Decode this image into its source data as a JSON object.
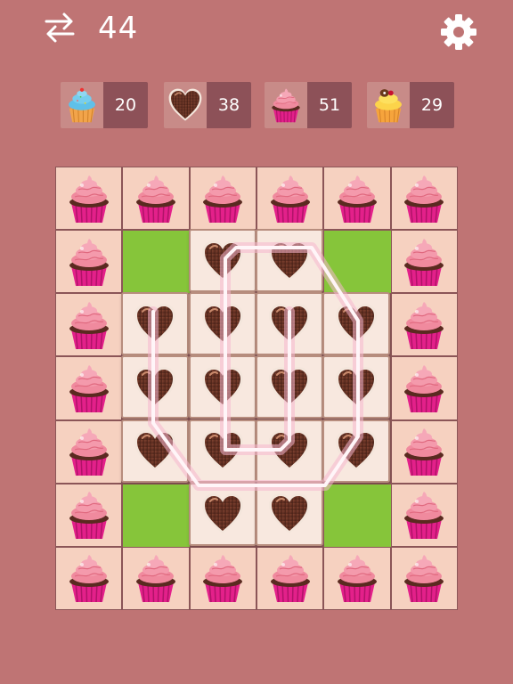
{
  "moves": "44",
  "goals": [
    {
      "item": "blue-cupcake",
      "count": "20"
    },
    {
      "item": "chocolate-heart",
      "count": "38"
    },
    {
      "item": "pink-cupcake",
      "count": "51"
    },
    {
      "item": "orange-cupcake",
      "count": "29"
    }
  ],
  "colors": {
    "background": "#bf7474",
    "board_cell": "#f6d1c0",
    "grass": "#86c53a",
    "path_glow": "#f4a9c6"
  },
  "board": {
    "rows": 7,
    "cols": 6,
    "layout": [
      [
        "pink-cupcake",
        "pink-cupcake",
        "pink-cupcake",
        "pink-cupcake",
        "pink-cupcake",
        "pink-cupcake"
      ],
      [
        "pink-cupcake",
        "grass",
        "chocolate-heart",
        "chocolate-heart",
        "grass",
        "pink-cupcake"
      ],
      [
        "pink-cupcake",
        "chocolate-heart",
        "chocolate-heart",
        "chocolate-heart",
        "chocolate-heart",
        "pink-cupcake"
      ],
      [
        "pink-cupcake",
        "chocolate-heart",
        "chocolate-heart",
        "chocolate-heart",
        "chocolate-heart",
        "pink-cupcake"
      ],
      [
        "pink-cupcake",
        "chocolate-heart",
        "chocolate-heart",
        "chocolate-heart",
        "chocolate-heart",
        "pink-cupcake"
      ],
      [
        "pink-cupcake",
        "grass",
        "chocolate-heart",
        "chocolate-heart",
        "grass",
        "pink-cupcake"
      ],
      [
        "pink-cupcake",
        "pink-cupcake",
        "pink-cupcake",
        "pink-cupcake",
        "pink-cupcake",
        "pink-cupcake"
      ]
    ]
  }
}
